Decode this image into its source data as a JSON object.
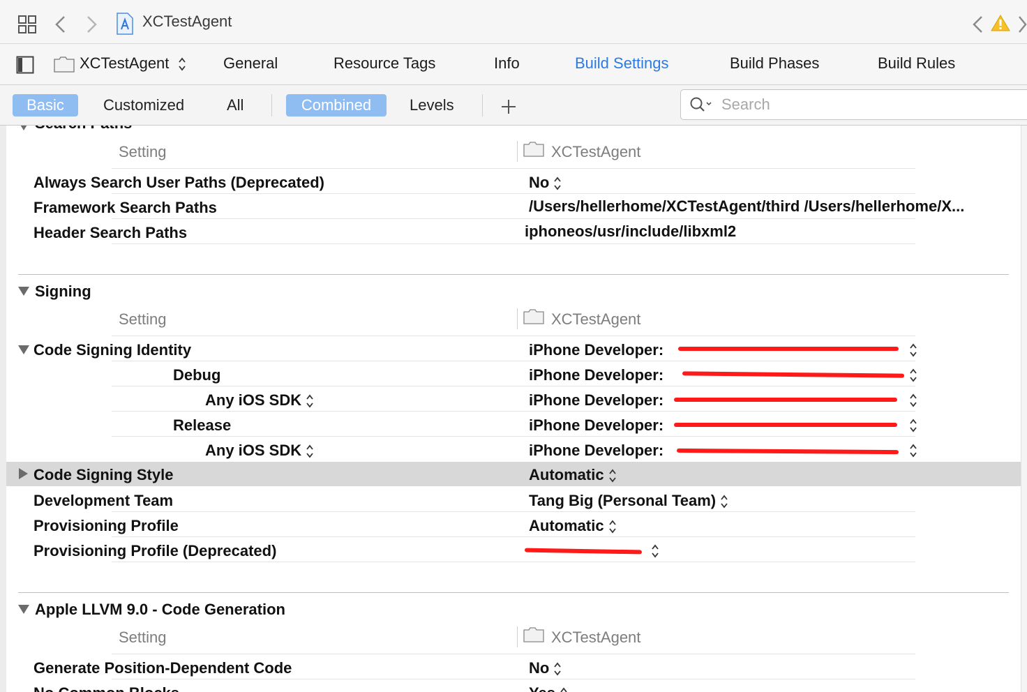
{
  "navbar": {
    "title": "XCTestAgent"
  },
  "tabs": {
    "target": "XCTestAgent",
    "items": [
      "General",
      "Resource Tags",
      "Info",
      "Build Settings",
      "Build Phases",
      "Build Rules"
    ],
    "active": "Build Settings"
  },
  "filter": {
    "basic": "Basic",
    "customized": "Customized",
    "all": "All",
    "combined": "Combined",
    "levels": "Levels",
    "search_placeholder": "Search"
  },
  "colors": {
    "accent": "#2b7be4",
    "selected_chip": "#8fbdf2",
    "redaction": "#ff1a1a",
    "row_highlight": "#d8d8d8"
  },
  "icons": [
    "grid-icon",
    "back-arrow-icon",
    "forward-arrow-icon",
    "xcode-project-icon",
    "warning-icon",
    "sidebar-toggle-icon",
    "folder-icon",
    "stepper-icon",
    "disclosure-triangle-icon",
    "plus-icon",
    "search-icon"
  ],
  "sections": {
    "search_paths": {
      "title": "Search Paths",
      "header_setting": "Setting",
      "header_target": "XCTestAgent",
      "rows": [
        {
          "label": "Always Search User Paths (Deprecated)",
          "value": "No"
        },
        {
          "label": "Framework Search Paths",
          "value": "/Users/hellerhome/XCTestAgent/third /Users/hellerhome/X..."
        },
        {
          "label": "Header Search Paths",
          "value": "iphoneos/usr/include/libxml2"
        }
      ]
    },
    "signing": {
      "title": "Signing",
      "header_setting": "Setting",
      "header_target": "XCTestAgent",
      "rows": [
        {
          "label": "Code Signing Identity",
          "value": "iPhone Developer:"
        },
        {
          "label": "Debug",
          "value": "iPhone Developer:"
        },
        {
          "label": "Any iOS SDK",
          "value": "iPhone Developer:"
        },
        {
          "label": "Release",
          "value": "iPhone Developer:"
        },
        {
          "label": "Any iOS SDK",
          "value": "iPhone Developer:"
        },
        {
          "label": "Code Signing Style",
          "value": "Automatic"
        },
        {
          "label": "Development Team",
          "value": "Tang Big (Personal Team)"
        },
        {
          "label": "Provisioning Profile",
          "value": "Automatic"
        },
        {
          "label": "Provisioning Profile (Deprecated)",
          "value": ""
        }
      ]
    },
    "codegen": {
      "title": "Apple LLVM 9.0 - Code Generation",
      "header_setting": "Setting",
      "header_target": "XCTestAgent",
      "rows": [
        {
          "label": "Generate Position-Dependent Code",
          "value": "No"
        },
        {
          "label": "No Common Blocks",
          "value": "Yes"
        }
      ]
    }
  }
}
